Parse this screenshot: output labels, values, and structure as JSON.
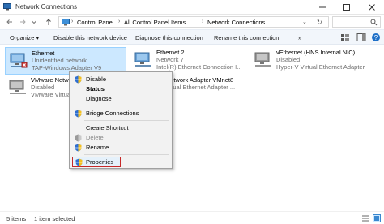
{
  "window": {
    "title": "Network Connections",
    "icons": [
      "network-connections-icon",
      "minimize-icon",
      "maximize-icon",
      "close-icon"
    ]
  },
  "address": {
    "breadcrumbs": [
      "Control Panel",
      "All Control Panel Items",
      "Network Connections"
    ],
    "icons": [
      "back-arrow-icon",
      "forward-arrow-icon",
      "up-arrow-icon",
      "computer-icon",
      "chevron-right-icon",
      "chevron-down-icon"
    ]
  },
  "commandbar": {
    "organize": "Organize ▾",
    "disable": "Disable this network device",
    "diagnose": "Diagnose this connection",
    "rename": "Rename this connection",
    "more": "»"
  },
  "adapters": [
    {
      "name": "Ethernet",
      "line2": "Unidentified network",
      "line3": "TAP-Windows Adapter V9",
      "selected": true,
      "icon": "network-adapter-icon"
    },
    {
      "name": "Ethernet 2",
      "line2": "Network 7",
      "line3": "Intel(R) Ethernet Connection I...",
      "selected": false,
      "icon": "network-adapter-icon"
    },
    {
      "name": "vEthernet (HNS Internal NIC)",
      "line2": "Disabled",
      "line3": "Hyper-V Virtual Ethernet Adapter",
      "selected": false,
      "icon": "network-adapter-disabled-icon"
    },
    {
      "name": "VMware Network",
      "line2": "Disabled",
      "line3": "VMware Virtual",
      "selected": false,
      "icon": "network-adapter-disabled-icon"
    },
    {
      "name": "re Network Adapter VMnet8",
      "line2": "",
      "line3": "e Virtual Ethernet Adapter ...",
      "selected": false,
      "icon": ""
    }
  ],
  "context_menu": {
    "items": [
      {
        "label": "Disable",
        "icon": "shield-icon",
        "bold": false,
        "disabled": false
      },
      {
        "label": "Status",
        "icon": "",
        "bold": true,
        "disabled": false
      },
      {
        "label": "Diagnose",
        "icon": "",
        "bold": false,
        "disabled": false
      },
      {
        "label": "Bridge Connections",
        "icon": "shield-icon",
        "bold": false,
        "disabled": false
      },
      {
        "label": "Create Shortcut",
        "icon": "",
        "bold": false,
        "disabled": false
      },
      {
        "label": "Delete",
        "icon": "shield-icon",
        "bold": false,
        "disabled": true
      },
      {
        "label": "Rename",
        "icon": "shield-icon",
        "bold": false,
        "disabled": false
      },
      {
        "label": "Properties",
        "icon": "shield-icon",
        "bold": false,
        "disabled": false,
        "highlighted": true
      }
    ]
  },
  "status": {
    "count": "5 items",
    "selected": "1 item selected",
    "view_icons": [
      "details-view-icon",
      "large-icons-view-icon"
    ]
  },
  "colors": {
    "selection": "#cce8ff",
    "commandbar": "#f2f6fb",
    "highlight_box": "#c62828"
  }
}
